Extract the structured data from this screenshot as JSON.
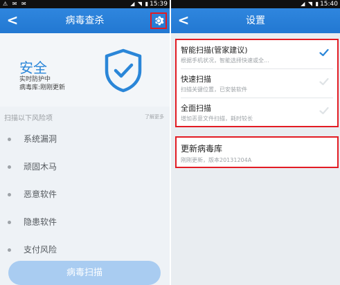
{
  "left": {
    "status_time": "15:39",
    "title": "病毒查杀",
    "back_glyph": "<",
    "status_label": "安全",
    "protection_text": "实时防护中",
    "database_text": "病毒库:刚刚更新",
    "section_label": "扫描以下风险项",
    "learn_more": "了解更多",
    "risk_items": [
      "系统漏洞",
      "顽固木马",
      "恶意软件",
      "隐患软件",
      "支付风险"
    ],
    "scan_button": "病毒扫描"
  },
  "right": {
    "status_time": "15:40",
    "title": "设置",
    "back_glyph": "<",
    "scan_modes": [
      {
        "name": "智能扫描(管家建议)",
        "desc": "根据手机状况，智能选择快速或全...",
        "selected": true
      },
      {
        "name": "快速扫描",
        "desc": "扫描关键位置，已安装软件",
        "selected": false
      },
      {
        "name": "全面扫描",
        "desc": "增加恶意文件扫描，耗时较长",
        "selected": false
      }
    ],
    "update": {
      "name": "更新病毒库",
      "desc": "刚刚更新，版本20131204A"
    }
  },
  "colors": {
    "title_bar": "#2278d2",
    "accent": "#2a86d8",
    "highlight_border": "#e21b23",
    "scan_button": "#a9ccf1"
  },
  "icons": {
    "gear": "gear-icon",
    "shield": "shield-check-icon",
    "check": "checkmark-icon",
    "back": "back-arrow-icon"
  }
}
